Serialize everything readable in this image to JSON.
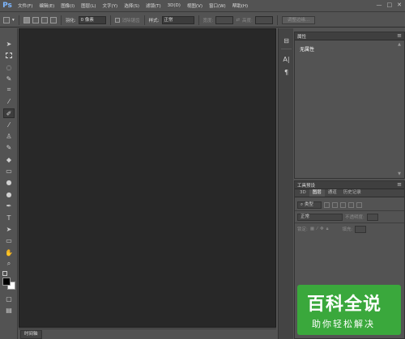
{
  "app": {
    "logo": "Ps"
  },
  "menu": [
    "文件(F)",
    "编辑(E)",
    "图像(I)",
    "图层(L)",
    "文字(Y)",
    "选择(S)",
    "滤镜(T)",
    "3D(D)",
    "视图(V)",
    "窗口(W)",
    "帮助(H)"
  ],
  "window_controls": {
    "minimize": "—",
    "maximize": "□",
    "close": "✕"
  },
  "options": {
    "feather_label": "羽化:",
    "feather_value": "0 像素",
    "antialias_label": "消除锯齿",
    "style_label": "样式:",
    "style_value": "正常",
    "width_label": "宽度:",
    "height_label": "高度:",
    "refine_edge_button": "调整边缘..."
  },
  "tools": [
    "move-icon",
    "marquee-icon",
    "lasso-icon",
    "quick-select-icon",
    "crop-icon",
    "eyedropper-icon",
    "healing-brush-icon",
    "brush-icon",
    "clone-stamp-icon",
    "history-brush-icon",
    "eraser-icon",
    "gradient-icon",
    "blur-icon",
    "dodge-icon",
    "pen-icon",
    "type-icon",
    "path-select-icon",
    "rectangle-icon",
    "hand-icon",
    "zoom-icon"
  ],
  "statusbar": {
    "timeline_tab": "时间轴"
  },
  "properties_panel": {
    "tab": "属性",
    "empty_text": "无属性"
  },
  "layers_panel": {
    "header_tab": "工具预设",
    "tabs": [
      "3D",
      "图层",
      "通道",
      "历史记录"
    ],
    "kind_label": "类型",
    "blend_mode": "正常",
    "opacity_label": "不透明度:",
    "lock_label": "锁定:",
    "fill_label": "填充:"
  },
  "watermark": {
    "title": "百科全说",
    "subtitle": "助你轻松解决"
  }
}
